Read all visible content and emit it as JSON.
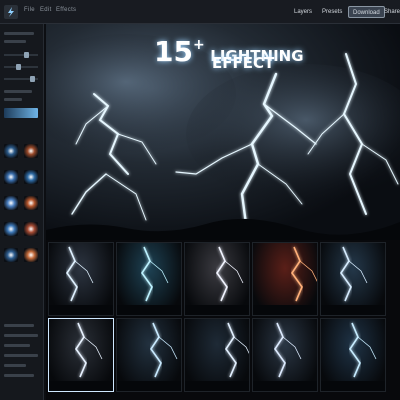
{
  "menu": {
    "tabs": [
      "File",
      "Edit",
      "Effects"
    ],
    "buttons": [
      "Layers",
      "Presets",
      "Download",
      "Share"
    ]
  },
  "hero": {
    "title_number": "15",
    "title_plus": "+",
    "title_line1": "LIGHTNING",
    "title_line2": "EFFECT"
  },
  "sidebar": {
    "thumb_colors": [
      "#2b5a8a",
      "#9a4a2a",
      "#3a6fae",
      "#2e6ba5",
      "#4a7fc0",
      "#b5562c",
      "#3d78b8",
      "#a64b33",
      "#2f5f92",
      "#c26a3a"
    ]
  },
  "grid": {
    "cells": [
      {
        "name": "preset-1",
        "tone": "#2c3440",
        "bolt": "#dff1ff"
      },
      {
        "name": "preset-2",
        "tone": "#1e4254",
        "bolt": "#bdf2ff"
      },
      {
        "name": "preset-3",
        "tone": "#3a3a40",
        "bolt": "#f1f4ff"
      },
      {
        "name": "preset-4",
        "tone": "#5a1f18",
        "bolt": "#ffb07a"
      },
      {
        "name": "preset-5",
        "tone": "#24384a",
        "bolt": "#d6ecff"
      },
      {
        "name": "preset-6",
        "tone": "#2a2f37",
        "bolt": "#e8f2ff"
      },
      {
        "name": "preset-7",
        "tone": "#22313f",
        "bolt": "#c9eaff"
      },
      {
        "name": "preset-8",
        "tone": "#1e2a36",
        "bolt": "#e2f0ff"
      },
      {
        "name": "preset-9",
        "tone": "#2a3644",
        "bolt": "#ddebff"
      },
      {
        "name": "preset-10",
        "tone": "#1f3346",
        "bolt": "#c7ecff"
      },
      {
        "name": "preset-11",
        "tone": "#4a2218",
        "bolt": "#ffcf9a"
      },
      {
        "name": "preset-12",
        "tone": "#2a2f36",
        "bolt": "#eaf2ff"
      }
    ]
  },
  "colors": {
    "accent": "#8fd0ff",
    "panel": "#15181d",
    "active_button": "#3a4350"
  }
}
